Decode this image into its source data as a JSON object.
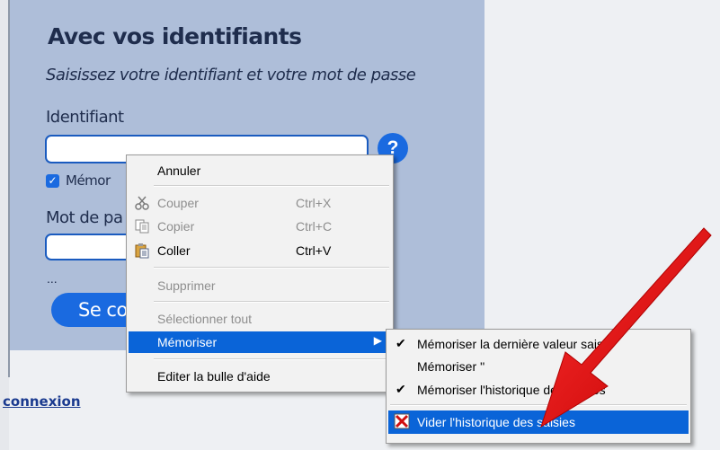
{
  "login": {
    "title": "Avec vos identifiants",
    "subtitle": "Saisissez votre identifiant et votre mot de passe",
    "username_label": "Identifiant",
    "remember_label": "Mémor",
    "password_label": "Mot de pa",
    "ellipsis": "...",
    "connect_button": "Se con",
    "help_symbol": "?",
    "connexion_link": "connexion"
  },
  "context_menu": {
    "items": [
      {
        "label": "Annuler",
        "shortcut": "",
        "disabled": false
      },
      {
        "label": "Couper",
        "shortcut": "Ctrl+X",
        "disabled": true,
        "icon": "scissors-icon"
      },
      {
        "label": "Copier",
        "shortcut": "Ctrl+C",
        "disabled": true,
        "icon": "copy-icon"
      },
      {
        "label": "Coller",
        "shortcut": "Ctrl+V",
        "disabled": false,
        "icon": "paste-icon"
      },
      {
        "label": "Supprimer",
        "shortcut": "",
        "disabled": true
      },
      {
        "label": "Sélectionner tout",
        "shortcut": "",
        "disabled": true
      },
      {
        "label": "Mémoriser",
        "shortcut": "",
        "disabled": false,
        "selected": true,
        "submenu_arrow": "▶"
      },
      {
        "label": "Editer la bulle d'aide",
        "shortcut": "",
        "disabled": false
      }
    ]
  },
  "submenu": {
    "items": [
      {
        "label": "Mémoriser la dernière valeur saisie",
        "checked": true
      },
      {
        "label": "Mémoriser ''",
        "checked": false
      },
      {
        "label": "Mémoriser l'historique des saisies",
        "checked": true
      },
      {
        "label": "Vider l'historique des saisies",
        "selected": true,
        "icon": "clear-history-icon"
      }
    ],
    "check_glyph": "✔"
  },
  "colors": {
    "panel": "#aebed9",
    "accent": "#1a6ae0",
    "menu_highlight": "#0a64d8",
    "annotation_arrow": "#e01010"
  }
}
